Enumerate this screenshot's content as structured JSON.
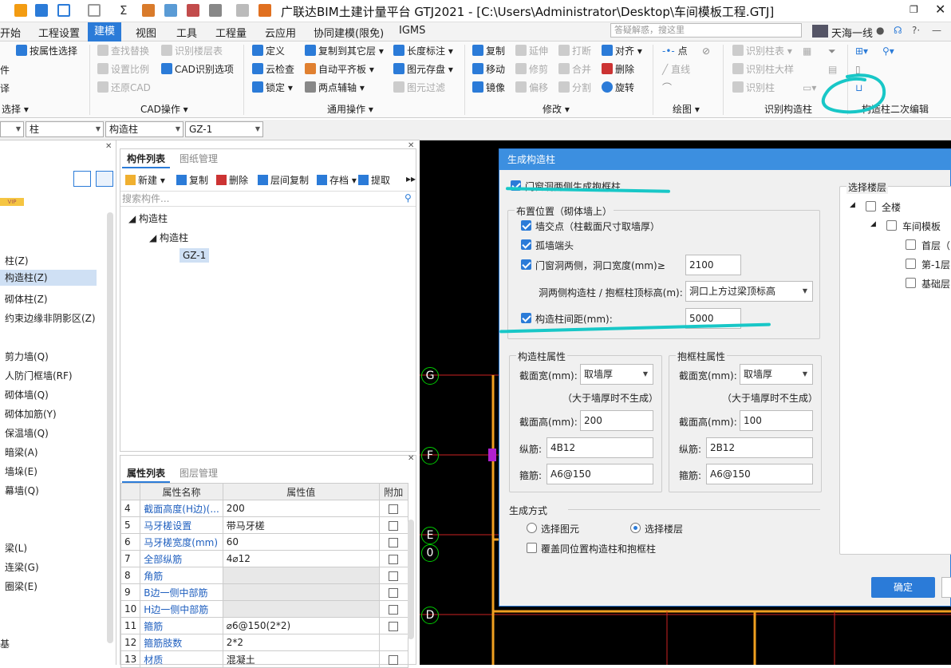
{
  "window": {
    "title": "广联达BIM土建计量平台 GTJ2021 - [C:\\Users\\Administrator\\Desktop\\车间模板工程.GTJ]",
    "user": "天海一线",
    "search_placeholder": "答疑解惑，搜这里"
  },
  "menu": [
    "开始",
    "工程设置",
    "建模",
    "视图",
    "工具",
    "工程量",
    "云应用",
    "协同建模(限免)",
    "IGMS"
  ],
  "menu_active": "建模",
  "ribbon": {
    "select": {
      "b1": "按属性选择",
      "b2": "件",
      "b3": "译",
      "group": "选择"
    },
    "cad": {
      "b1": "查找替换",
      "b2": "识别楼层表",
      "b3": "设置比例",
      "b4": "CAD识别选项",
      "b5": "还原CAD",
      "group": "CAD操作"
    },
    "common": {
      "b1": "定义",
      "b2": "复制到其它层",
      "b3": "长度标注",
      "b4": "云检查",
      "b5": "自动平齐板",
      "b6": "图元存盘",
      "b7": "锁定",
      "b8": "两点辅轴",
      "b9": "图元过滤",
      "group": "通用操作"
    },
    "modify": {
      "b1": "复制",
      "b2": "延伸",
      "b3": "打断",
      "b4": "对齐",
      "b5": "移动",
      "b6": "修剪",
      "b7": "合并",
      "b8": "删除",
      "b9": "镜像",
      "b10": "偏移",
      "b11": "分割",
      "b12": "旋转",
      "group": "修改"
    },
    "draw": {
      "b1": "点",
      "b2": "直线",
      "group": "绘图"
    },
    "identify": {
      "b1": "识别柱表",
      "b2": "识别柱大样",
      "b3": "识别柱",
      "group": "识别构造柱"
    },
    "edit2": {
      "group": "构造柱二次编辑"
    }
  },
  "propbar": {
    "c1": "柱",
    "c2": "构造柱",
    "c3": "GZ-1"
  },
  "left_panel": {
    "vip": "VIP",
    "items": [
      "柱(Z)",
      "构造柱(Z)",
      "砌体柱(Z)",
      "约束边缘非阴影区(Z)",
      "剪力墙(Q)",
      "人防门框墙(RF)",
      "砌体墙(Q)",
      "砌体加筋(Y)",
      "保温墙(Q)",
      "暗梁(A)",
      "墙垛(E)",
      "幕墙(Q)",
      "梁(L)",
      "连梁(G)",
      "圈梁(E)",
      "基"
    ],
    "selected": "构造柱(Z)"
  },
  "component_list": {
    "tab_active": "构件列表",
    "tab_other": "图纸管理",
    "toolbar": [
      "新建",
      "复制",
      "删除",
      "层间复制",
      "存档",
      "提取"
    ],
    "search_placeholder": "搜索构件...",
    "tree": {
      "root": "构造柱",
      "child": "构造柱",
      "leaf": "GZ-1"
    }
  },
  "property_list": {
    "tab_active": "属性列表",
    "tab_other": "图层管理",
    "headers": [
      "属性名称",
      "属性值",
      "附加"
    ],
    "rows": [
      {
        "no": "4",
        "name": "截面高度(H边)(...",
        "value": "200"
      },
      {
        "no": "5",
        "name": "马牙槎设置",
        "value": "带马牙槎"
      },
      {
        "no": "6",
        "name": "马牙槎宽度(mm)",
        "value": "60"
      },
      {
        "no": "7",
        "name": "全部纵筋",
        "value": "4⌀12"
      },
      {
        "no": "8",
        "name": "角筋",
        "value": ""
      },
      {
        "no": "9",
        "name": "B边一侧中部筋",
        "value": ""
      },
      {
        "no": "10",
        "name": "H边一侧中部筋",
        "value": ""
      },
      {
        "no": "11",
        "name": "箍筋",
        "value": "⌀6@150(2*2)"
      },
      {
        "no": "12",
        "name": "箍筋肢数",
        "value": "2*2"
      },
      {
        "no": "13",
        "name": "材质",
        "value": "混凝土"
      }
    ]
  },
  "canvas": {
    "axes": [
      "G",
      "F",
      "E",
      "0",
      "D"
    ]
  },
  "dialog": {
    "title": "生成构造柱",
    "opt_door": "门窗洞两侧生成抱框柱",
    "layout_title": "布置位置（砌体墙上）",
    "pos1": "墙交点（柱截面尺寸取墙厚）",
    "pos2": "孤墙端头",
    "pos3": "门窗洞两侧，洞口宽度(mm)≥",
    "pos3_val": "2100",
    "top_label": "洞两侧构造柱 / 抱框柱顶标高(m):",
    "top_val": "洞口上方过梁顶标高",
    "pos4": "构造柱间距(mm):",
    "pos4_val": "5000",
    "gz_title": "构造柱属性",
    "bk_title": "抱框柱属性",
    "w_label": "截面宽(mm):",
    "h_label": "截面高(mm):",
    "note": "（大于墙厚时不生成）",
    "zj_label": "纵筋:",
    "gj_label": "箍筋:",
    "gz": {
      "w": "取墙厚",
      "h": "200",
      "zj": "4B12",
      "gj": "A6@150"
    },
    "bk": {
      "w": "取墙厚",
      "h": "100",
      "zj": "2B12",
      "gj": "A6@150"
    },
    "gen_title": "生成方式",
    "r1": "选择图元",
    "r2": "选择楼层",
    "overwrite": "覆盖同位置构造柱和抱框柱",
    "floors_title": "选择楼层",
    "floors": {
      "all": "全楼",
      "proj": "车间模板",
      "f1": "首层（",
      "f2": "第-1层",
      "f3": "基础层"
    },
    "ok": "确定"
  },
  "colors": {
    "accent": "#2b7bd8",
    "annotation": "#18c7c7",
    "grid_red": "#cc2222",
    "column_orange": "#f0a020"
  }
}
